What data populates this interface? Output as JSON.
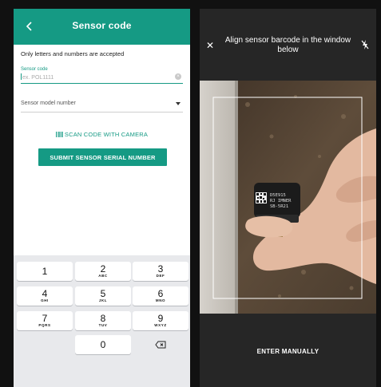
{
  "entry_screen": {
    "title": "Sensor code",
    "hint": "Only letters and numbers are accepted",
    "sensor_code": {
      "label": "Sensor code",
      "placeholder": "ex. POL1111",
      "value": ""
    },
    "model": {
      "placeholder": "Sensor model number"
    },
    "scan_label": "SCAN CODE WITH CAMERA",
    "submit_label": "SUBMIT SENSOR SERIAL NUMBER",
    "keypad": [
      {
        "digit": "1",
        "letters": ""
      },
      {
        "digit": "2",
        "letters": "ABC"
      },
      {
        "digit": "3",
        "letters": "DEF"
      },
      {
        "digit": "4",
        "letters": "GHI"
      },
      {
        "digit": "5",
        "letters": "JKL"
      },
      {
        "digit": "6",
        "letters": "MNO"
      },
      {
        "digit": "7",
        "letters": "PQRS"
      },
      {
        "digit": "8",
        "letters": "TUV"
      },
      {
        "digit": "9",
        "letters": "WXYZ"
      },
      {
        "digit": "0",
        "letters": ""
      }
    ]
  },
  "camera_screen": {
    "instruction": "Align sensor barcode in the window below",
    "manual_label": "ENTER MANUALLY",
    "sensor_label_lines": [
      "D5E915",
      "RJ IMNER",
      "SB-5R21"
    ]
  },
  "colors": {
    "accent": "#159a84",
    "keypad_bg": "#e8e9ec",
    "camera_bar": "#262626"
  }
}
